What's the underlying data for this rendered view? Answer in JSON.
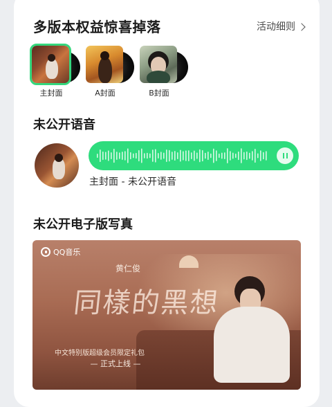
{
  "section_versions": {
    "title": "多版本权益惊喜掉落",
    "rules_link": "活动细则",
    "covers": [
      {
        "label": "主封面",
        "selected": true
      },
      {
        "label": "A封面",
        "selected": false
      },
      {
        "label": "B封面",
        "selected": false
      }
    ]
  },
  "section_voice": {
    "title": "未公开语音",
    "caption": "主封面 - 未公开语音",
    "state": "playing"
  },
  "section_photobook": {
    "title": "未公开电子版写真",
    "poster": {
      "brand": "QQ音乐",
      "artist": "黄仁俊",
      "album_title": "同樣的黑想",
      "subtitle": "中文特别版超级会员限定礼包",
      "launch": "— 正式上线 —"
    }
  },
  "colors": {
    "accent_green": "#2edc7d",
    "card_bg": "#ffffff",
    "page_bg": "#eceef1"
  }
}
